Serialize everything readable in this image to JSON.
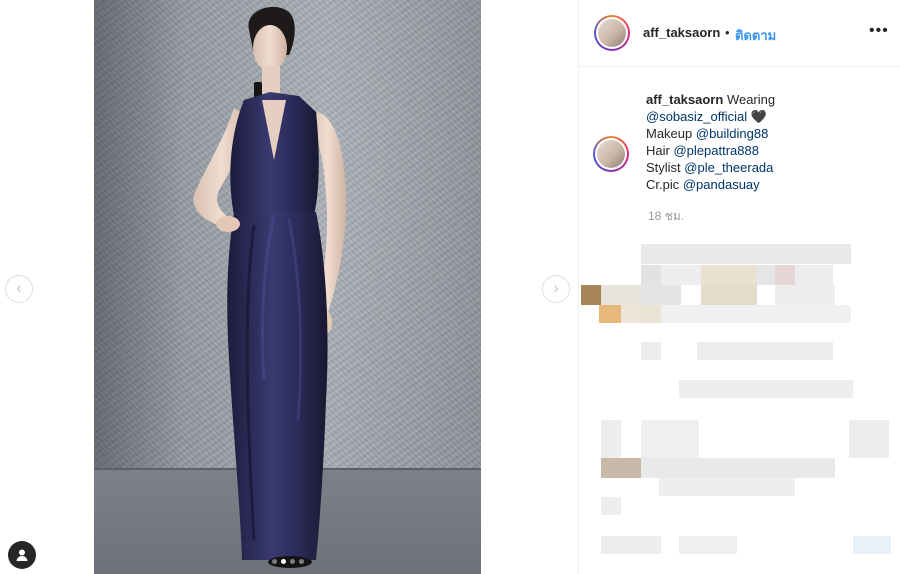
{
  "post": {
    "username": "aff_taksaorn",
    "bullet": "•",
    "follow_label": "ติดตาม",
    "more_label": "•••",
    "caption": {
      "username": "aff_taksaorn",
      "intro": "Wearing",
      "mention_brand": "@sobasiz_official",
      "brand_emoji": "🖤",
      "makeup_label": "Makeup",
      "makeup_mention": "@building88",
      "hair_label": "Hair",
      "hair_mention": "@plepattra888",
      "stylist_label": "Stylist",
      "stylist_mention": "@ple_theerada",
      "credit_label": "Cr.pic",
      "credit_mention": "@pandasuay"
    },
    "timestamp": "18 ชม."
  },
  "viewer": {
    "prev_icon": "‹",
    "next_icon": "›",
    "slide_count": 4,
    "active_slide": 2
  },
  "icons": {
    "user_tag": "user-tag-icon",
    "more": "more-options-icon"
  },
  "colors": {
    "link": "#3897f0",
    "mention": "#003569",
    "muted": "#999999",
    "dress": "#2a2a55"
  }
}
